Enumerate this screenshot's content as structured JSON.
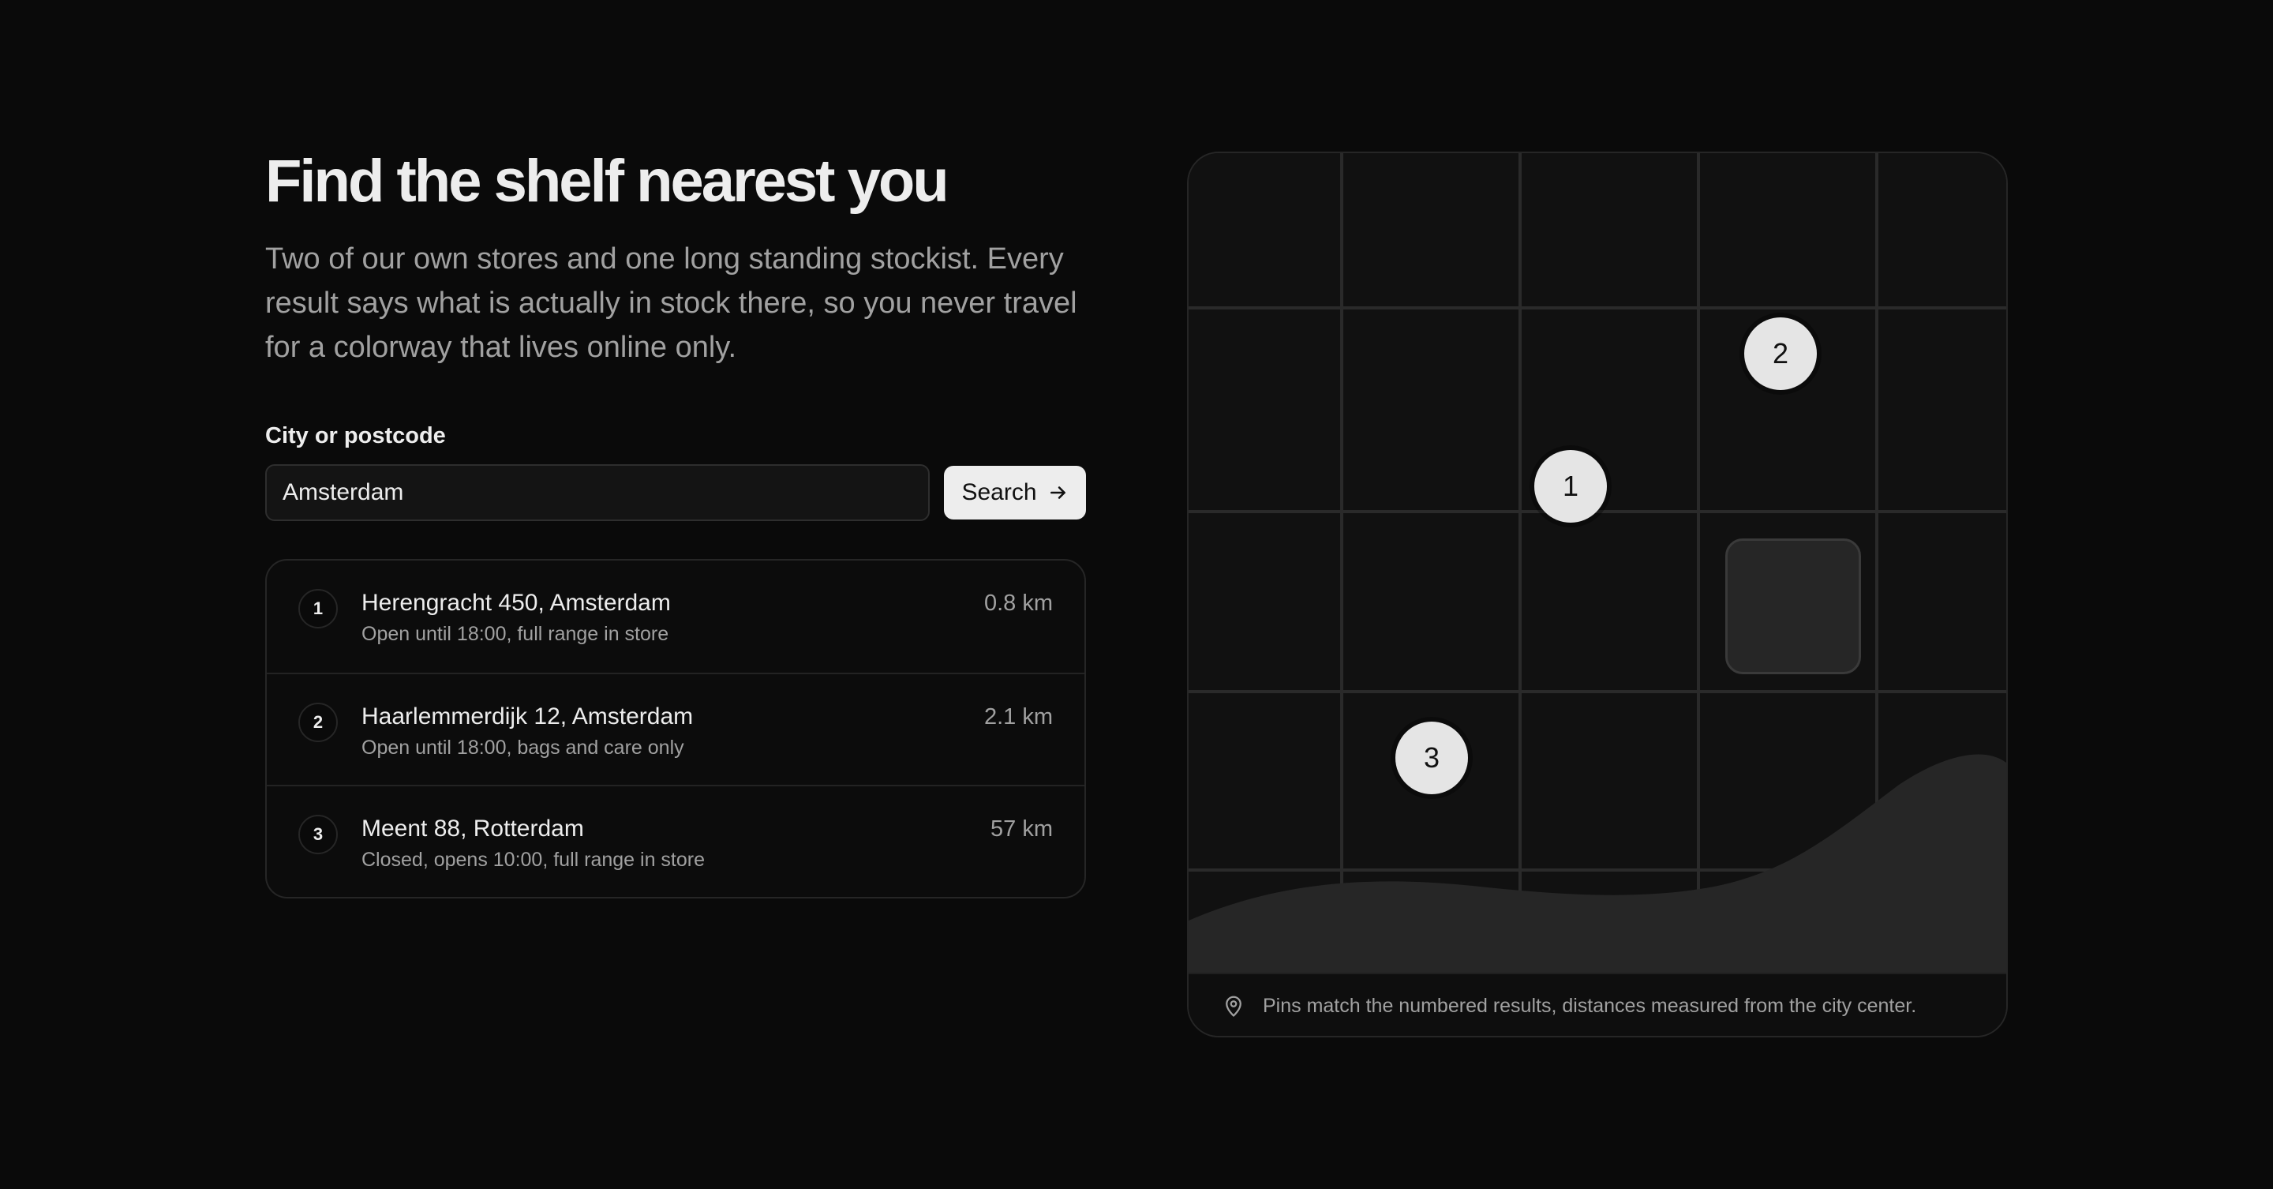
{
  "header": {
    "title": "Find the shelf nearest you",
    "lede": "Two of our own stores and one long standing stockist. Every result says what is actually in stock there, so you never travel for a colorway that lives online only."
  },
  "search": {
    "label": "City or postcode",
    "value": "Amsterdam",
    "button_label": "Search",
    "button_icon": "arrow-right-icon"
  },
  "results": [
    {
      "number": "1",
      "name": "Herengracht 450, Amsterdam",
      "detail": "Open until 18:00, full range in store",
      "distance": "0.8 km"
    },
    {
      "number": "2",
      "name": "Haarlemmerdijk 12, Amsterdam",
      "detail": "Open until 18:00, bags and care only",
      "distance": "2.1 km"
    },
    {
      "number": "3",
      "name": "Meent 88, Rotterdam",
      "detail": "Closed, opens 10:00, full range in store",
      "distance": "57 km"
    }
  ],
  "map": {
    "pins": [
      "1",
      "2",
      "3"
    ],
    "footer_note": "Pins match the numbered results, distances measured from the city center.",
    "footer_icon": "map-pin-icon"
  },
  "colors": {
    "background": "#0a0a0a",
    "text": "#ededed",
    "muted": "#a1a1a1",
    "pin": "#e5e5e5"
  }
}
